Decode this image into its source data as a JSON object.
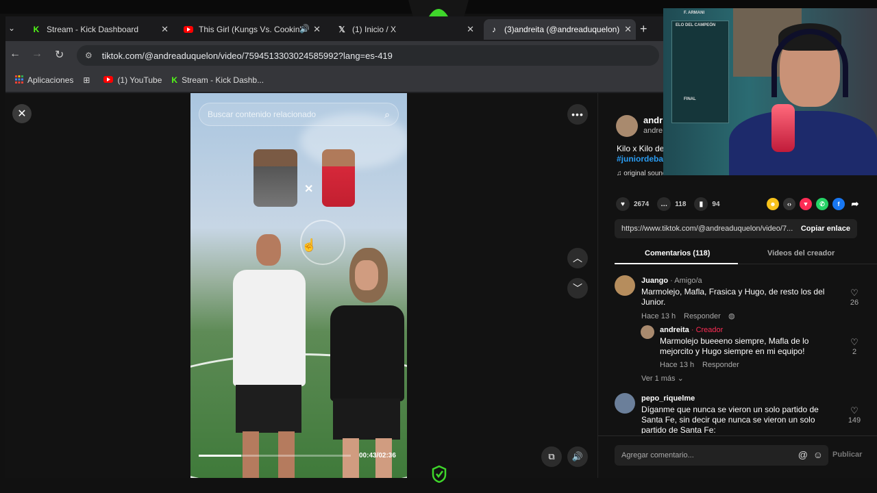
{
  "browser": {
    "tabs": [
      {
        "title": "Stream - Kick Dashboard",
        "icon": "kick-icon",
        "active": false
      },
      {
        "title": "This Girl (Kungs Vs. Cookin'",
        "icon": "youtube-icon",
        "active": false
      },
      {
        "title": "(1) Inicio / X",
        "icon": "x-icon",
        "active": false
      },
      {
        "title": "(3)andreita (@andreaduquelon)",
        "icon": "tiktok-icon",
        "active": true
      }
    ],
    "url": "tiktok.com/@andreaduquelon/video/7594513303024585992?lang=es-419",
    "bookmarks": [
      {
        "label": "Aplicaciones",
        "icon": "apps-grid-icon"
      },
      {
        "label": "",
        "icon": "grid-icon"
      },
      {
        "label": "(1) YouTube",
        "icon": "youtube-icon"
      },
      {
        "label": "Stream - Kick Dashb...",
        "icon": "kick-icon"
      }
    ]
  },
  "video": {
    "search_placeholder": "Buscar contenido relacionado",
    "time": "00:43/02:36",
    "progress": 0.28
  },
  "panel": {
    "author_name": "andr",
    "author_handle": "andre",
    "caption": "Kilo x Kilo de",
    "hashtag": "#juniordeba",
    "sound": "original sound - andreita",
    "likes": "2674",
    "comments": "118",
    "saves": "94",
    "share_link": "https://www.tiktok.com/@andreaduquelon/video/7...",
    "copy_label": "Copiar enlace",
    "tab_comments": "Comentarios (118)",
    "tab_creator": "Videos del creador",
    "comment_placeholder": "Agregar comentario...",
    "publish_label": "Publicar"
  },
  "comments": [
    {
      "user": "Juango",
      "tag": " · Amigo/a",
      "text": "Marmolejo, Mafla, Frasica y Hugo, de resto los del Junior.",
      "time": "Hace 13 h",
      "reply": "Responder",
      "likes": "26"
    },
    {
      "user": "andreita",
      "tag": " · Creador",
      "text": "Marmolejo bueeeno siempre, Mafla de lo mejorcito y Hugo siempre en mi equipo!",
      "time": "Hace 13 h",
      "reply": "Responder",
      "likes": "2",
      "more": "Ver 1 más"
    },
    {
      "user": "pepo_riquelme",
      "tag": "",
      "text": "Díganme que nunca se vieron un solo partido de Santa Fe, sin decir que nunca se vieron un solo partido de Santa Fe:",
      "likes": "149"
    }
  ],
  "webcam": {
    "label_top": "F. ARMANI",
    "label_board": "ELO DEL CAMPEÓN",
    "label_final": "FINAL"
  },
  "colors": {
    "tiktok_red": "#fe2c55",
    "link_blue": "#2a9cf2",
    "kick_green": "#53fc18"
  }
}
